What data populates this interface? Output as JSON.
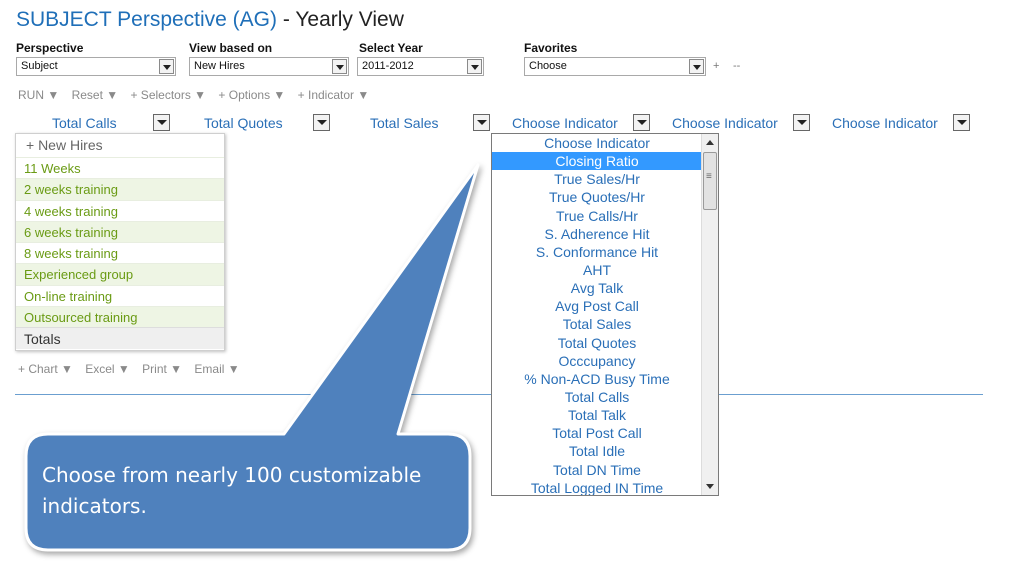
{
  "title": {
    "main": "SUBJECT Perspective (AG)",
    "separator": " - ",
    "sub": "Yearly View"
  },
  "filters": {
    "perspective": {
      "label": "Perspective",
      "value": "Subject"
    },
    "view_based_on": {
      "label": "View based on",
      "value": "New Hires"
    },
    "select_year": {
      "label": "Select Year",
      "value": "2011-2012"
    },
    "favorites": {
      "label": "Favorites",
      "value": "Choose",
      "add": "+",
      "remove": "--"
    }
  },
  "toolbar": [
    "RUN ▼",
    "Reset ▼",
    "+ Selectors ▼",
    "+ Options ▼",
    "+ Indicator ▼"
  ],
  "columns": [
    "Total Calls",
    "Total Quotes",
    "Total Sales",
    "Choose Indicator",
    "Choose Indicator",
    "Choose Indicator"
  ],
  "group_menu": {
    "header": "+ New Hires",
    "items": [
      "11 Weeks",
      "2 weeks training",
      "4 weeks training",
      "6 weeks training",
      "8 weeks training",
      "Experienced group",
      "On-line training",
      "Outsourced training"
    ],
    "totals": "Totals"
  },
  "footbar": [
    "+ Chart ▼",
    "Excel ▼",
    "Print ▼",
    "Email ▼"
  ],
  "indicator_dropdown": {
    "selected": "Closing Ratio",
    "options": [
      "Choose Indicator",
      "Closing Ratio",
      "True Sales/Hr",
      "True Quotes/Hr",
      "True Calls/Hr",
      "S. Adherence Hit",
      "S. Conformance Hit",
      "AHT",
      "Avg Talk",
      "Avg Post Call",
      "Total Sales",
      "Total Quotes",
      "Occcupancy",
      "% Non-ACD Busy Time",
      "Total Calls",
      "Total Talk",
      "Total Post Call",
      "Total Idle",
      "Total DN Time",
      "Total Logged IN Time"
    ]
  },
  "callout": {
    "text": "Choose from nearly 100 customizable indicators."
  },
  "colors": {
    "title_blue": "#1f6fb8",
    "link_blue": "#2a6fb7",
    "green_item": "#6a9b14",
    "highlight": "#3399ff",
    "callout_fill": "#4f81bd",
    "callout_stroke": "#ffffff"
  },
  "icons": {
    "dropdown_arrow": "chevron-down-icon",
    "scroll_up": "scroll-up-icon",
    "scroll_down": "scroll-down-icon"
  }
}
